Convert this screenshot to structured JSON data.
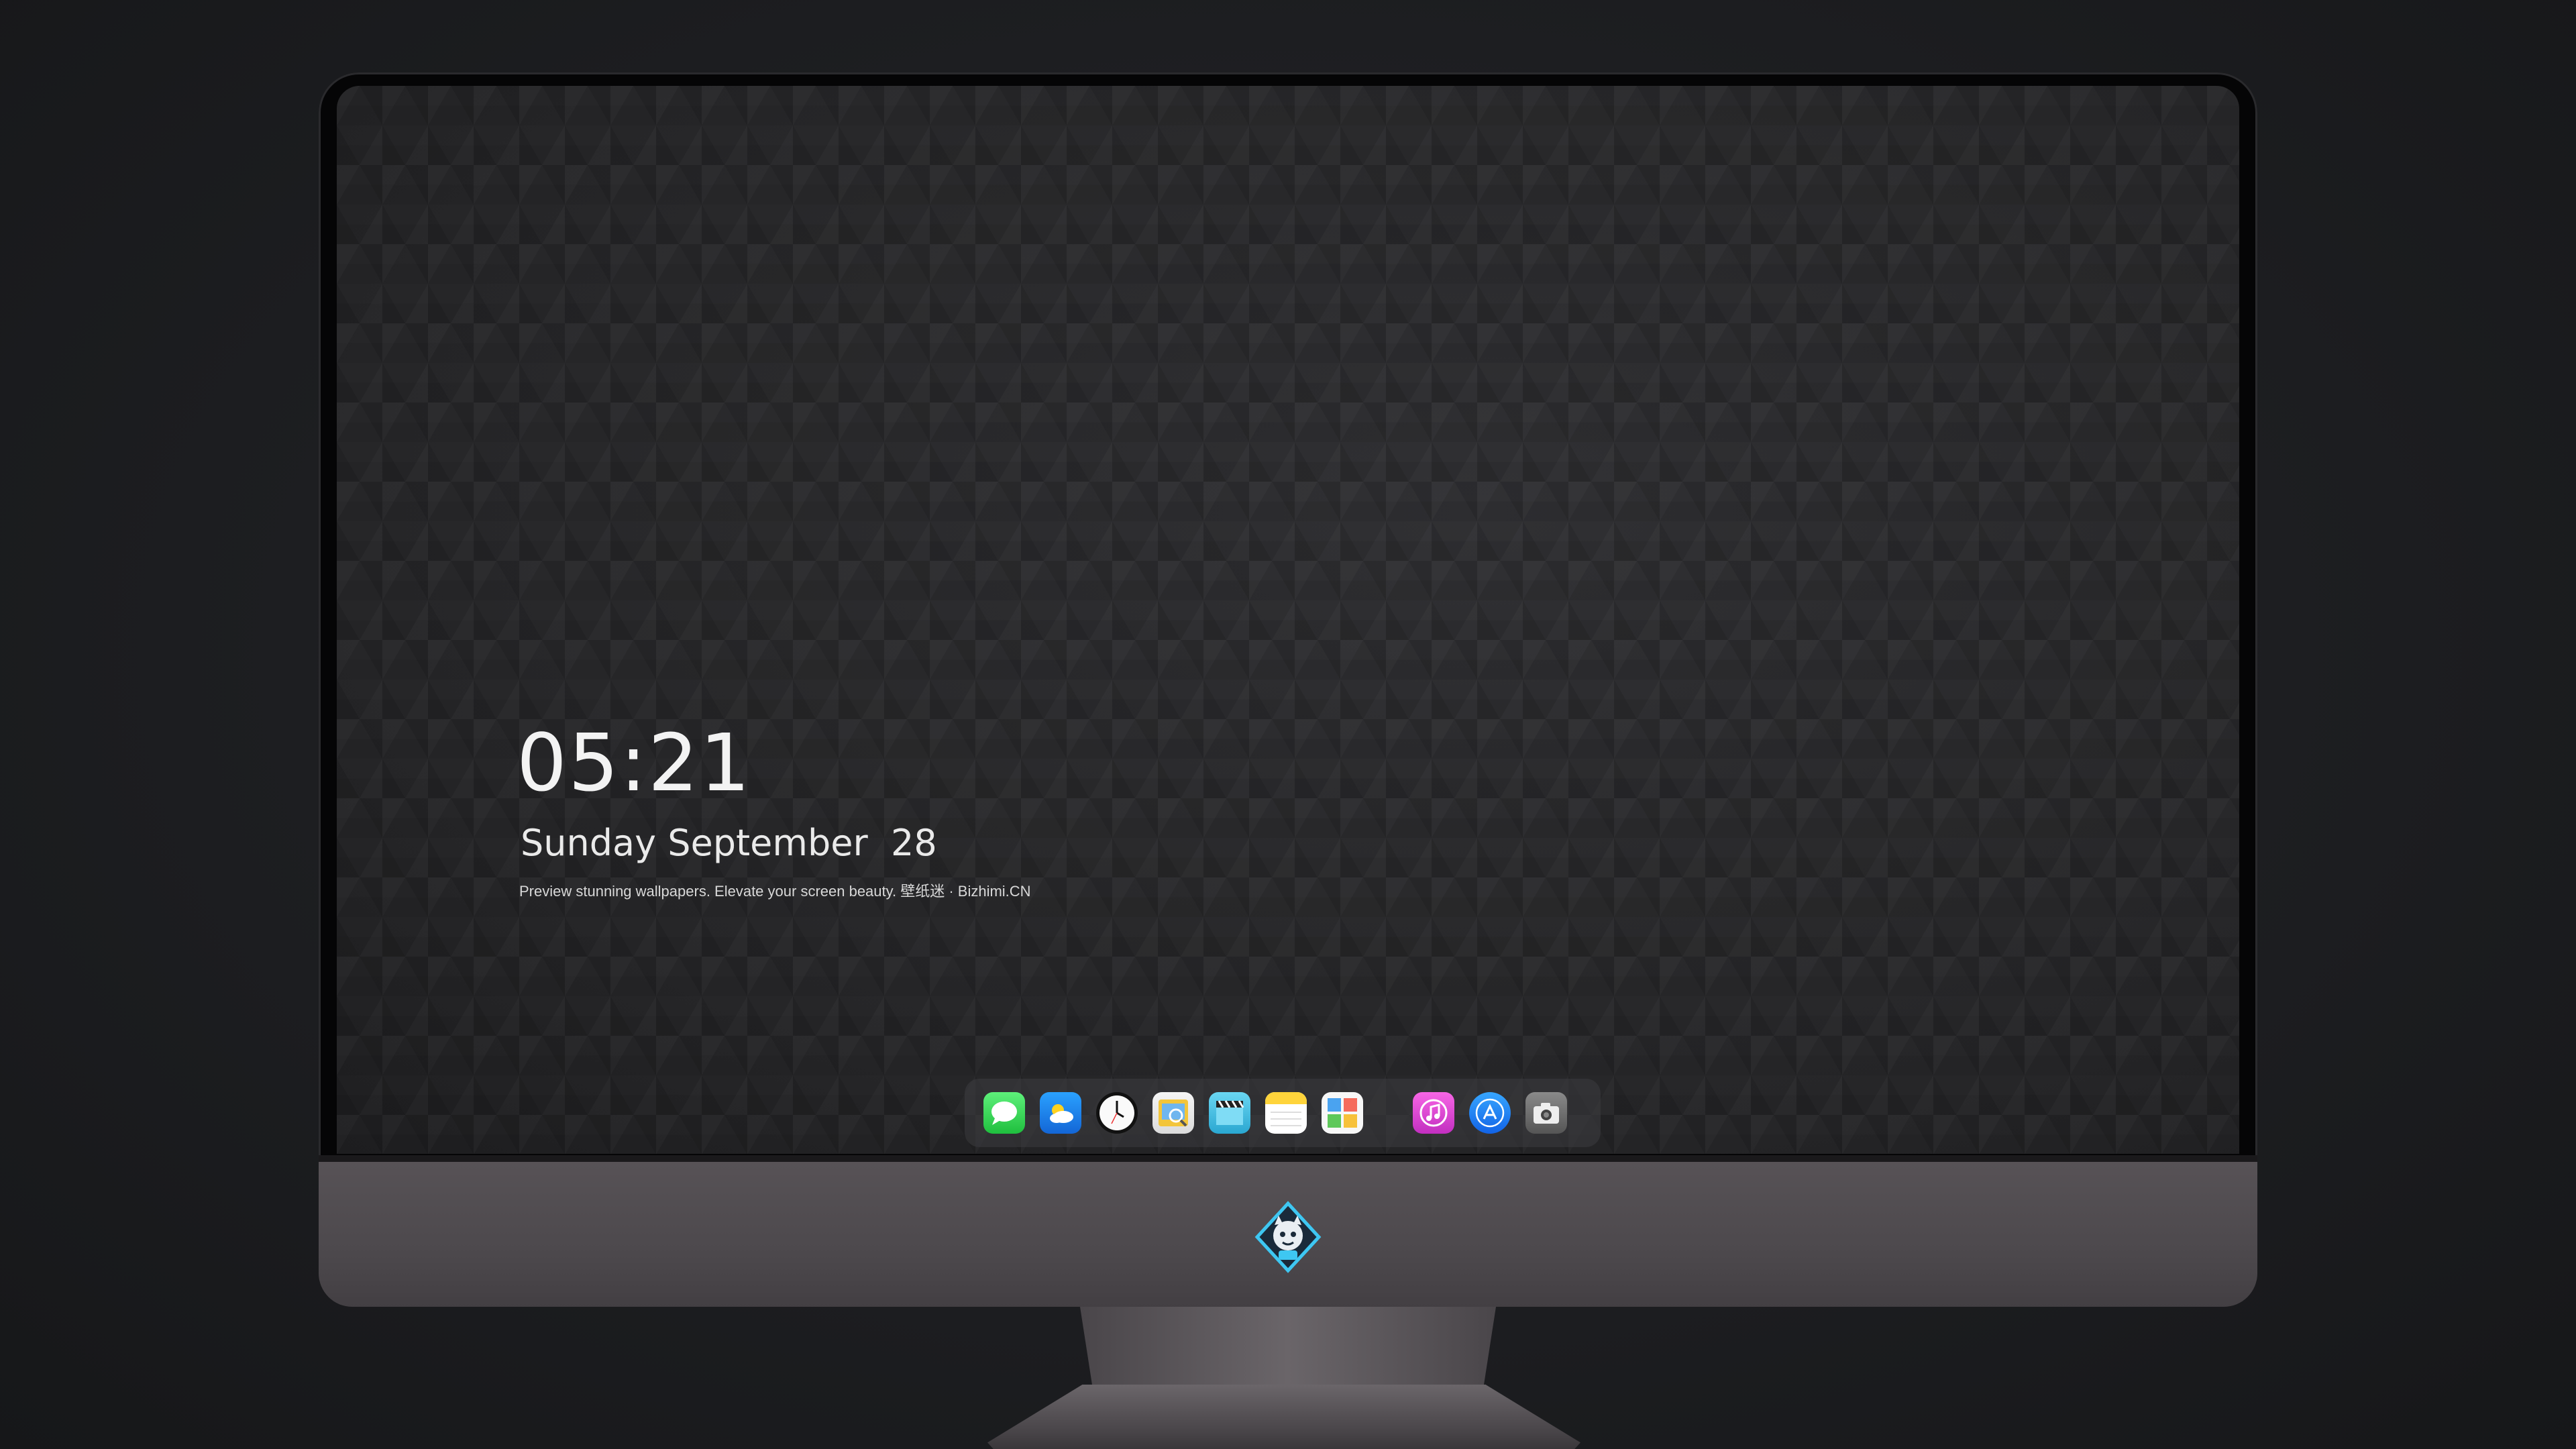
{
  "lockscreen": {
    "time": "05:21",
    "date": "Sunday September  28",
    "tagline": "Preview stunning wallpapers. Elevate your screen beauty. 壁纸迷 · Bizhimi.CN"
  },
  "dock": {
    "apps": [
      {
        "name": "messages-icon",
        "color": "#2bd150"
      },
      {
        "name": "weather-icon",
        "color": "#1e90ff"
      },
      {
        "name": "clock-icon",
        "color": "#1a1a1a"
      },
      {
        "name": "preview-icon",
        "color": "#f2c230"
      },
      {
        "name": "video-clapper-icon",
        "color": "#46c3e6"
      },
      {
        "name": "notes-icon",
        "color": "#ffd642"
      },
      {
        "name": "photo-collage-icon",
        "color": "#f4f4f4"
      },
      {
        "name": "music-icon",
        "color": "#e43fd0"
      },
      {
        "name": "app-store-icon",
        "color": "#1b8cf5"
      },
      {
        "name": "camera-icon",
        "color": "#6e6e6e"
      }
    ]
  },
  "monitor": {
    "logo_icon": "shield-mascot-logo-icon"
  }
}
